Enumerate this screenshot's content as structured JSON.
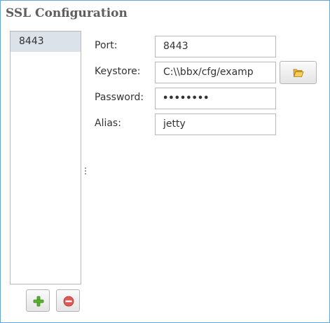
{
  "panel": {
    "title": "SSL Configuration"
  },
  "list": {
    "items": [
      {
        "label": "8443",
        "selected": true
      }
    ]
  },
  "toolbar": {
    "add_icon": "plus-icon",
    "remove_icon": "minus-circle-icon"
  },
  "form": {
    "port_label": "Port:",
    "port_value": "8443",
    "keystore_label": "Keystore:",
    "keystore_value": "C:\\\\bbx/cfg/examp",
    "keystore_browse_icon": "folder-open-icon",
    "password_label": "Password:",
    "password_value": "••••••••",
    "alias_label": "Alias:",
    "alias_value": "jetty"
  },
  "colors": {
    "frame_border": "#62a6d8",
    "title_text": "#5e5e5e",
    "selected_item_bg": "#dbe2ea",
    "add_icon": "#5cb030",
    "remove_icon": "#d9534f"
  }
}
